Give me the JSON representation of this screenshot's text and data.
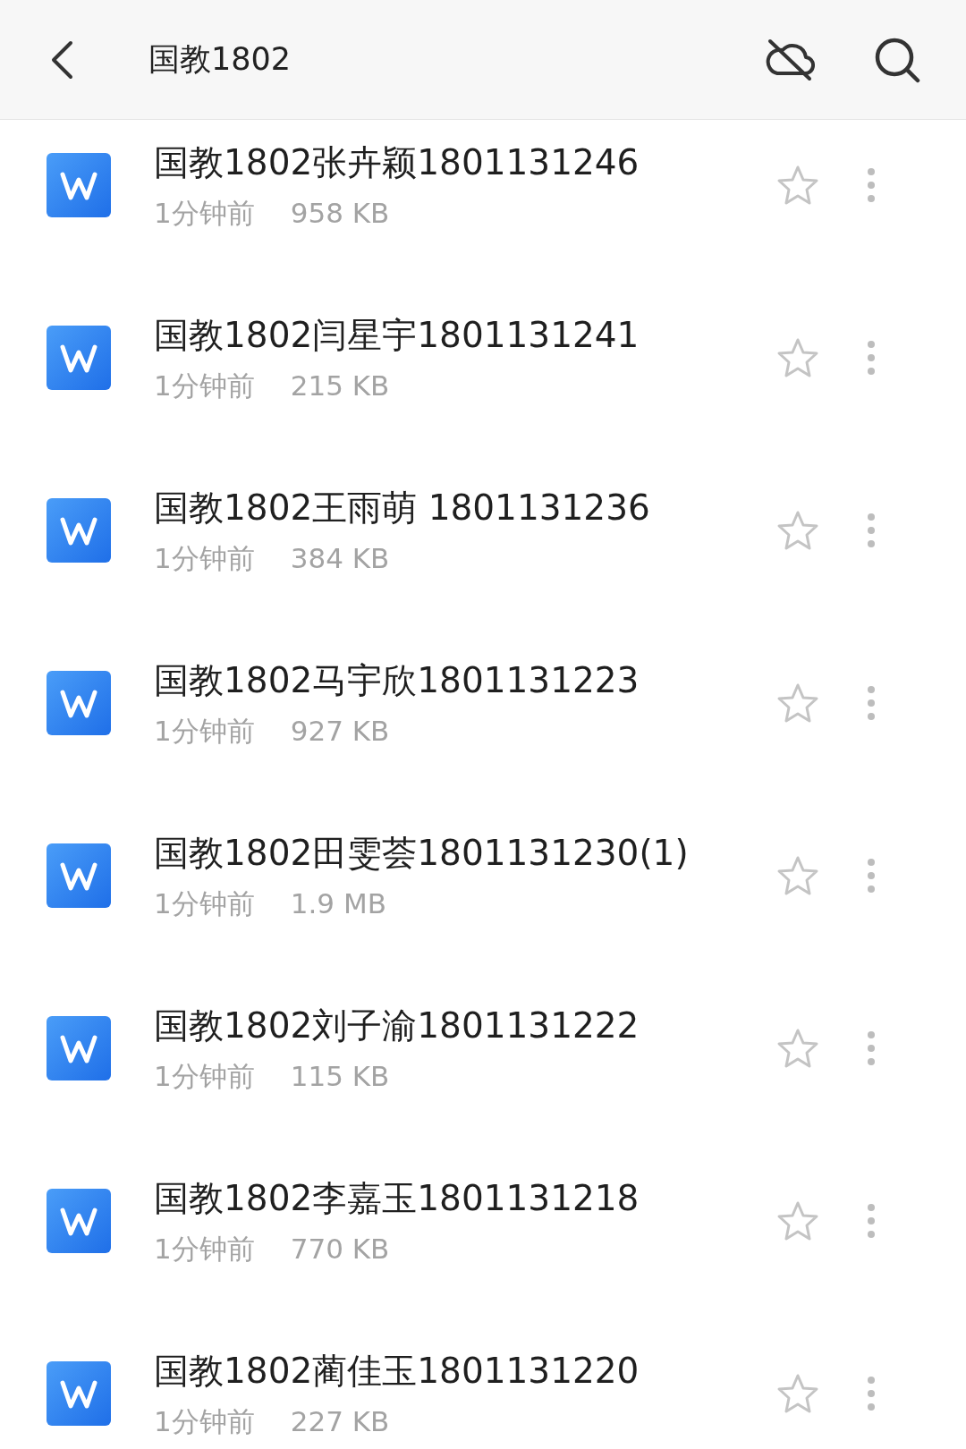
{
  "header": {
    "title": "国教1802"
  },
  "files": [
    {
      "name": "国教1802张卉颖1801131246",
      "time": "1分钟前",
      "size": "958 KB",
      "starred": false
    },
    {
      "name": "国教1802闫星宇1801131241",
      "time": "1分钟前",
      "size": "215 KB",
      "starred": false
    },
    {
      "name": "国教1802王雨萌 1801131236",
      "time": "1分钟前",
      "size": "384 KB",
      "starred": false
    },
    {
      "name": "国教1802马宇欣1801131223",
      "time": "1分钟前",
      "size": "927 KB",
      "starred": false
    },
    {
      "name": "国教1802田雯荟1801131230(1)",
      "time": "1分钟前",
      "size": "1.9 MB",
      "starred": false
    },
    {
      "name": "国教1802刘子渝1801131222",
      "time": "1分钟前",
      "size": "115 KB",
      "starred": false
    },
    {
      "name": "国教1802李嘉玉1801131218",
      "time": "1分钟前",
      "size": "770 KB",
      "starred": false
    },
    {
      "name": "国教1802蔺佳玉1801131220",
      "time": "1分钟前",
      "size": "227 KB",
      "starred": false
    }
  ]
}
